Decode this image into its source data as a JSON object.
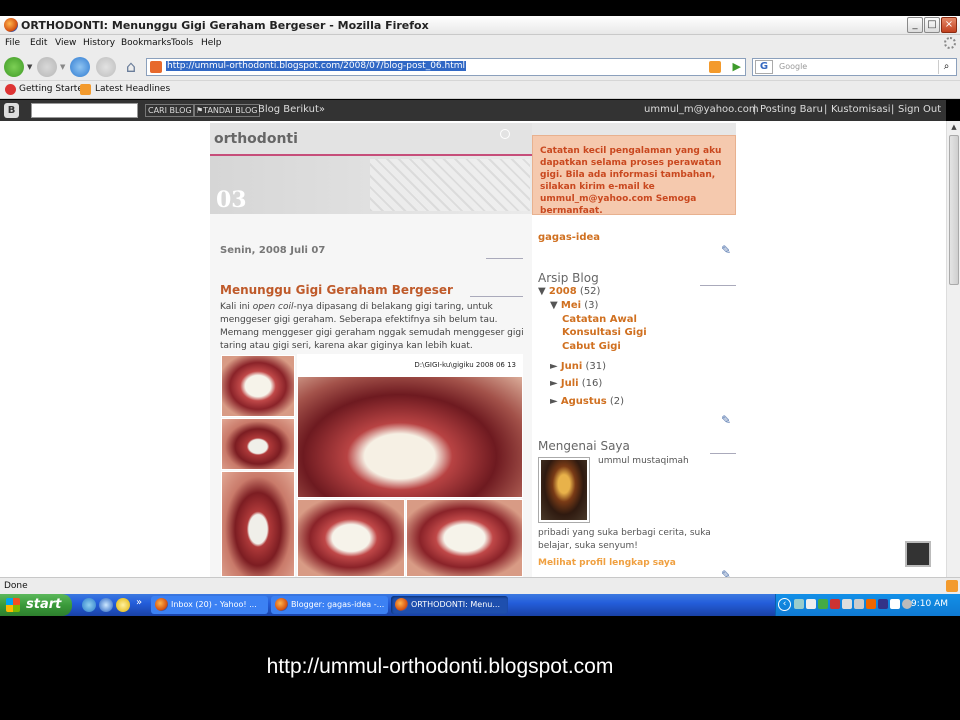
{
  "window": {
    "title": "ORTHODONTI: Menunggu Gigi Geraham Bergeser - Mozilla Firefox",
    "controls": [
      "_",
      "□",
      "×"
    ]
  },
  "menu": [
    "File",
    "Edit",
    "View",
    "History",
    "Bookmarks",
    "Tools",
    "Help"
  ],
  "address_bar": {
    "url": "http://ummul-orthodonti.blogspot.com/2008/07/blog-post_06.html"
  },
  "search_bar": {
    "engine": "G",
    "placeholder": "Google"
  },
  "bookmarks": [
    "Getting Started",
    "Latest Headlines"
  ],
  "blogger_bar": {
    "search_button": "CARI BLOG",
    "flag_button": "TANDAI BLOG",
    "next_blog": "Blog Berikut»",
    "email": "ummul_m@yahoo.com",
    "links": [
      "Posting Baru",
      "Kustomisasi",
      "Sign Out"
    ],
    "separator": "|"
  },
  "blog": {
    "title": "orthodonti",
    "header_number": "03",
    "description": "Catatan kecil pengalaman yang aku dapatkan selama proses perawatan gigi. Bila ada informasi tambahan, silakan kirim e-mail ke ummul_m@yahoo.com Semoga bermanfaat.",
    "date": "Senin, 2008 Juli 07",
    "post_title": "Menunggu Gigi Geraham Bergeser",
    "post_body_1": "Kali ini ",
    "post_body_italic": "open coil",
    "post_body_2": "-nya dipasang di belakang gigi taring, untuk menggeser gigi geraham. Seberapa efektifnya sih belum tau. Memang menggeser gigi geraham nggak semudah menggeser gigi taring atau gigi seri, karena akar giginya kan lebih kuat.",
    "photo_caption": "D:\\GIGI-ku\\gigiku 2008 06 13"
  },
  "sidebar": {
    "gadget_link": "gagas-idea",
    "archive_title": "Arsip Blog",
    "archive": {
      "year": "2008",
      "year_count": "(52)",
      "month_open": "Mei",
      "month_open_count": "(3)",
      "posts": [
        "Catatan Awal",
        "Konsultasi Gigi",
        "Cabut Gigi"
      ],
      "months": [
        {
          "name": "Juni",
          "count": "(31)"
        },
        {
          "name": "Juli",
          "count": "(16)"
        },
        {
          "name": "Agustus",
          "count": "(2)"
        }
      ],
      "expanded_marker": "▼",
      "collapsed_marker": "►"
    },
    "about_title": "Mengenai Saya",
    "about_name": "ummul mustaqimah",
    "about_text": "pribadi yang suka berbagi cerita, suka belajar, suka senyum!",
    "profile_link": "Melihat profil lengkap saya"
  },
  "status": {
    "text": "Done"
  },
  "taskbar": {
    "start": "start",
    "tasks": [
      "Inbox (20) - Yahoo! ...",
      "Blogger: gagas-idea -...",
      "ORTHODONTI: Menu..."
    ],
    "clock": "9:10 AM",
    "more_arrow": "»"
  },
  "caption": "http://ummul-orthodonti.blogspot.com"
}
